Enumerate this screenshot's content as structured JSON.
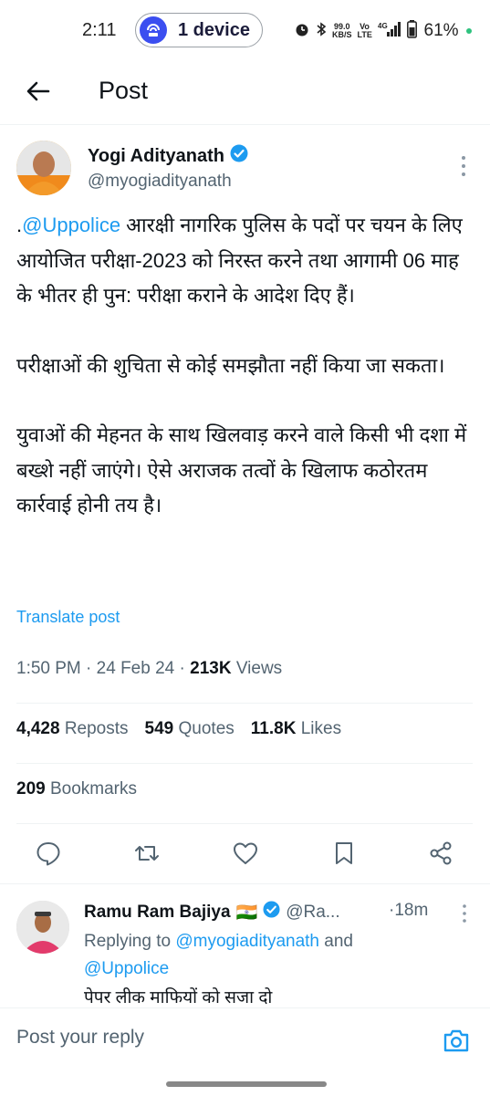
{
  "status_bar": {
    "time": "2:11",
    "device_pill": "1 device",
    "net_speed_value": "99.0",
    "net_speed_unit": "KB/S",
    "volte": "Vo LTE",
    "network": "4G",
    "battery": "61%"
  },
  "header": {
    "title": "Post"
  },
  "post": {
    "author_name": "Yogi Adityanath",
    "author_handle": "@myogiadityanath",
    "text_prefix": ".",
    "mention": "@Uppolice",
    "paragraph1_rest": " आरक्षी नागरिक पुलिस के पदों पर चयन के लिए आयोजित परीक्षा-2023 को निरस्त करने तथा आगामी 06 माह के भीतर ही पुन: परीक्षा कराने के आदेश दिए हैं।",
    "paragraph2": "परीक्षाओं की शुचिता से कोई समझौता नहीं किया जा सकता।",
    "paragraph3": "युवाओं की मेहनत के साथ खिलवाड़ करने वाले किसी भी दशा में बख्शे नहीं जाएंगे। ऐसे अराजक तत्वों के खिलाफ कठोरतम कार्रवाई होनी तय है।",
    "translate": "Translate post",
    "time": "1:50 PM",
    "date": "24 Feb 24",
    "views_count": "213K",
    "views_label": "Views",
    "reposts_count": "4,428",
    "reposts_label": "Reposts",
    "quotes_count": "549",
    "quotes_label": "Quotes",
    "likes_count": "11.8K",
    "likes_label": "Likes",
    "bookmarks_count": "209",
    "bookmarks_label": "Bookmarks"
  },
  "reply": {
    "name": "Ramu Ram Bajiya",
    "flag": "🇮🇳",
    "handle": "@Ra...",
    "time": "·18m",
    "replying_prefix": "Replying to ",
    "replying_user1": "@myogiadityanath",
    "replying_and": " and",
    "replying_user2": "@Uppolice",
    "body": "पेपर लीक माफियों को सजा दो"
  },
  "compose": {
    "placeholder": "Post your reply"
  },
  "colors": {
    "accent": "#1d9bf0",
    "secondary_text": "#536471",
    "pill": "#3b4ef0"
  },
  "icons": [
    "back-arrow-icon",
    "verified-icon",
    "more-icon",
    "reply-icon",
    "repost-icon",
    "like-icon",
    "bookmark-icon",
    "share-icon",
    "camera-icon"
  ]
}
